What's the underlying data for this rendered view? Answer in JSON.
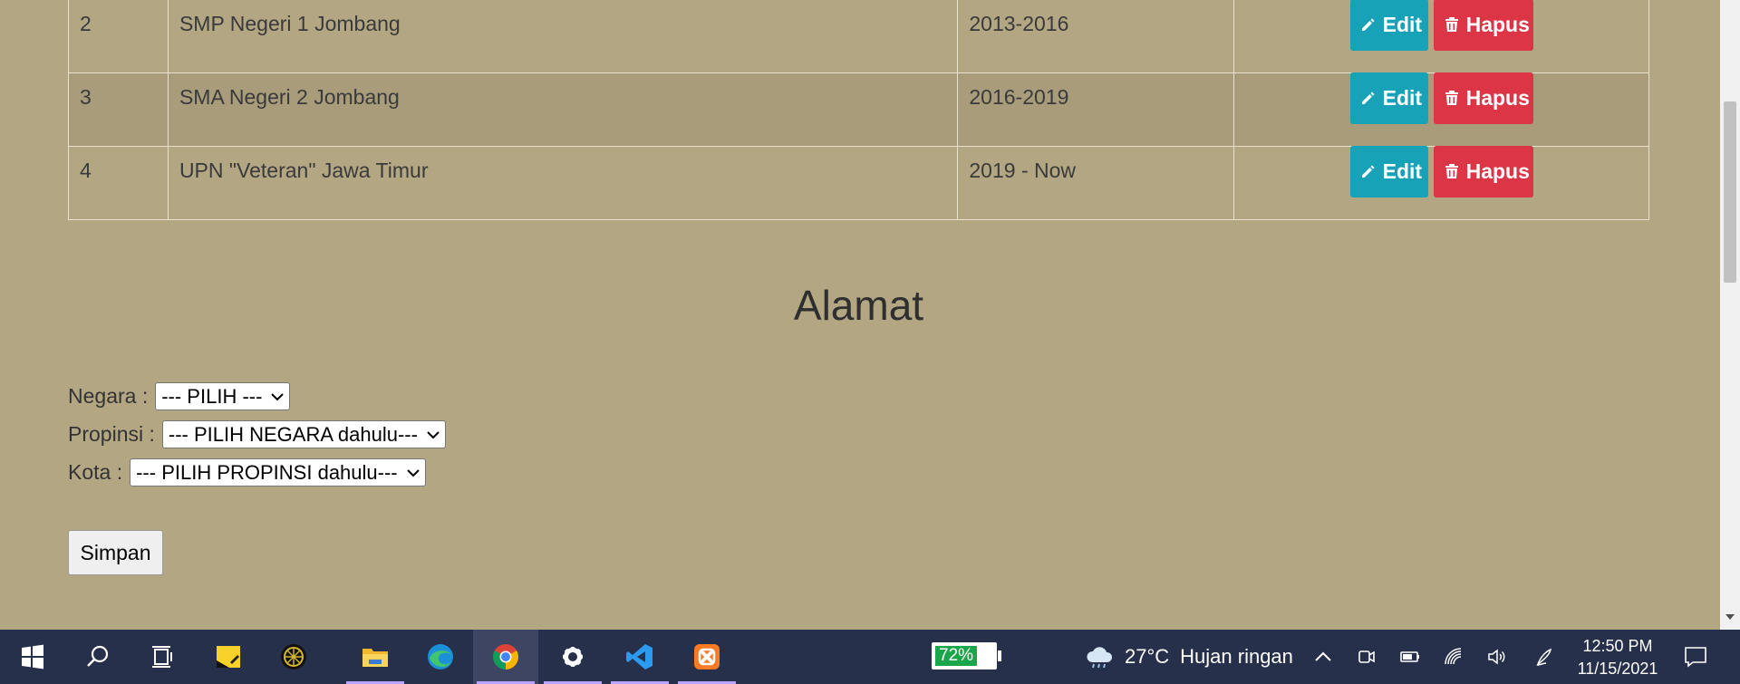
{
  "table": {
    "rows": [
      {
        "no": "2",
        "school": "SMP Negeri 1 Jombang",
        "years": "2013-2016"
      },
      {
        "no": "3",
        "school": "SMA Negeri 2 Jombang",
        "years": "2016-2019"
      },
      {
        "no": "4",
        "school": "UPN \"Veteran\" Jawa Timur",
        "years": "2019 - Now"
      }
    ],
    "edit_label": "Edit",
    "delete_label": "Hapus"
  },
  "address": {
    "title": "Alamat",
    "negara_label": "Negara :",
    "negara_value": "--- PILIH ---",
    "propinsi_label": "Propinsi :",
    "propinsi_value": "--- PILIH NEGARA dahulu---",
    "kota_label": "Kota :",
    "kota_value": "--- PILIH PROPINSI dahulu---",
    "save_label": "Simpan"
  },
  "taskbar": {
    "apps": [
      "start-icon",
      "search-icon",
      "task-view-icon",
      "sticky-notes-icon",
      "app-globe-icon",
      "file-explorer-icon",
      "edge-icon",
      "chrome-icon",
      "settings-icon",
      "vscode-icon",
      "xampp-icon"
    ],
    "battery": "72%",
    "temperature": "27°C",
    "weather": "Hujan ringan",
    "time": "12:50 PM",
    "date": "11/15/2021"
  },
  "colors": {
    "page_bg": "#b3a683",
    "edit_button": "#17a2b8",
    "delete_button": "#dc3545",
    "taskbar_bg": "#26304a"
  }
}
